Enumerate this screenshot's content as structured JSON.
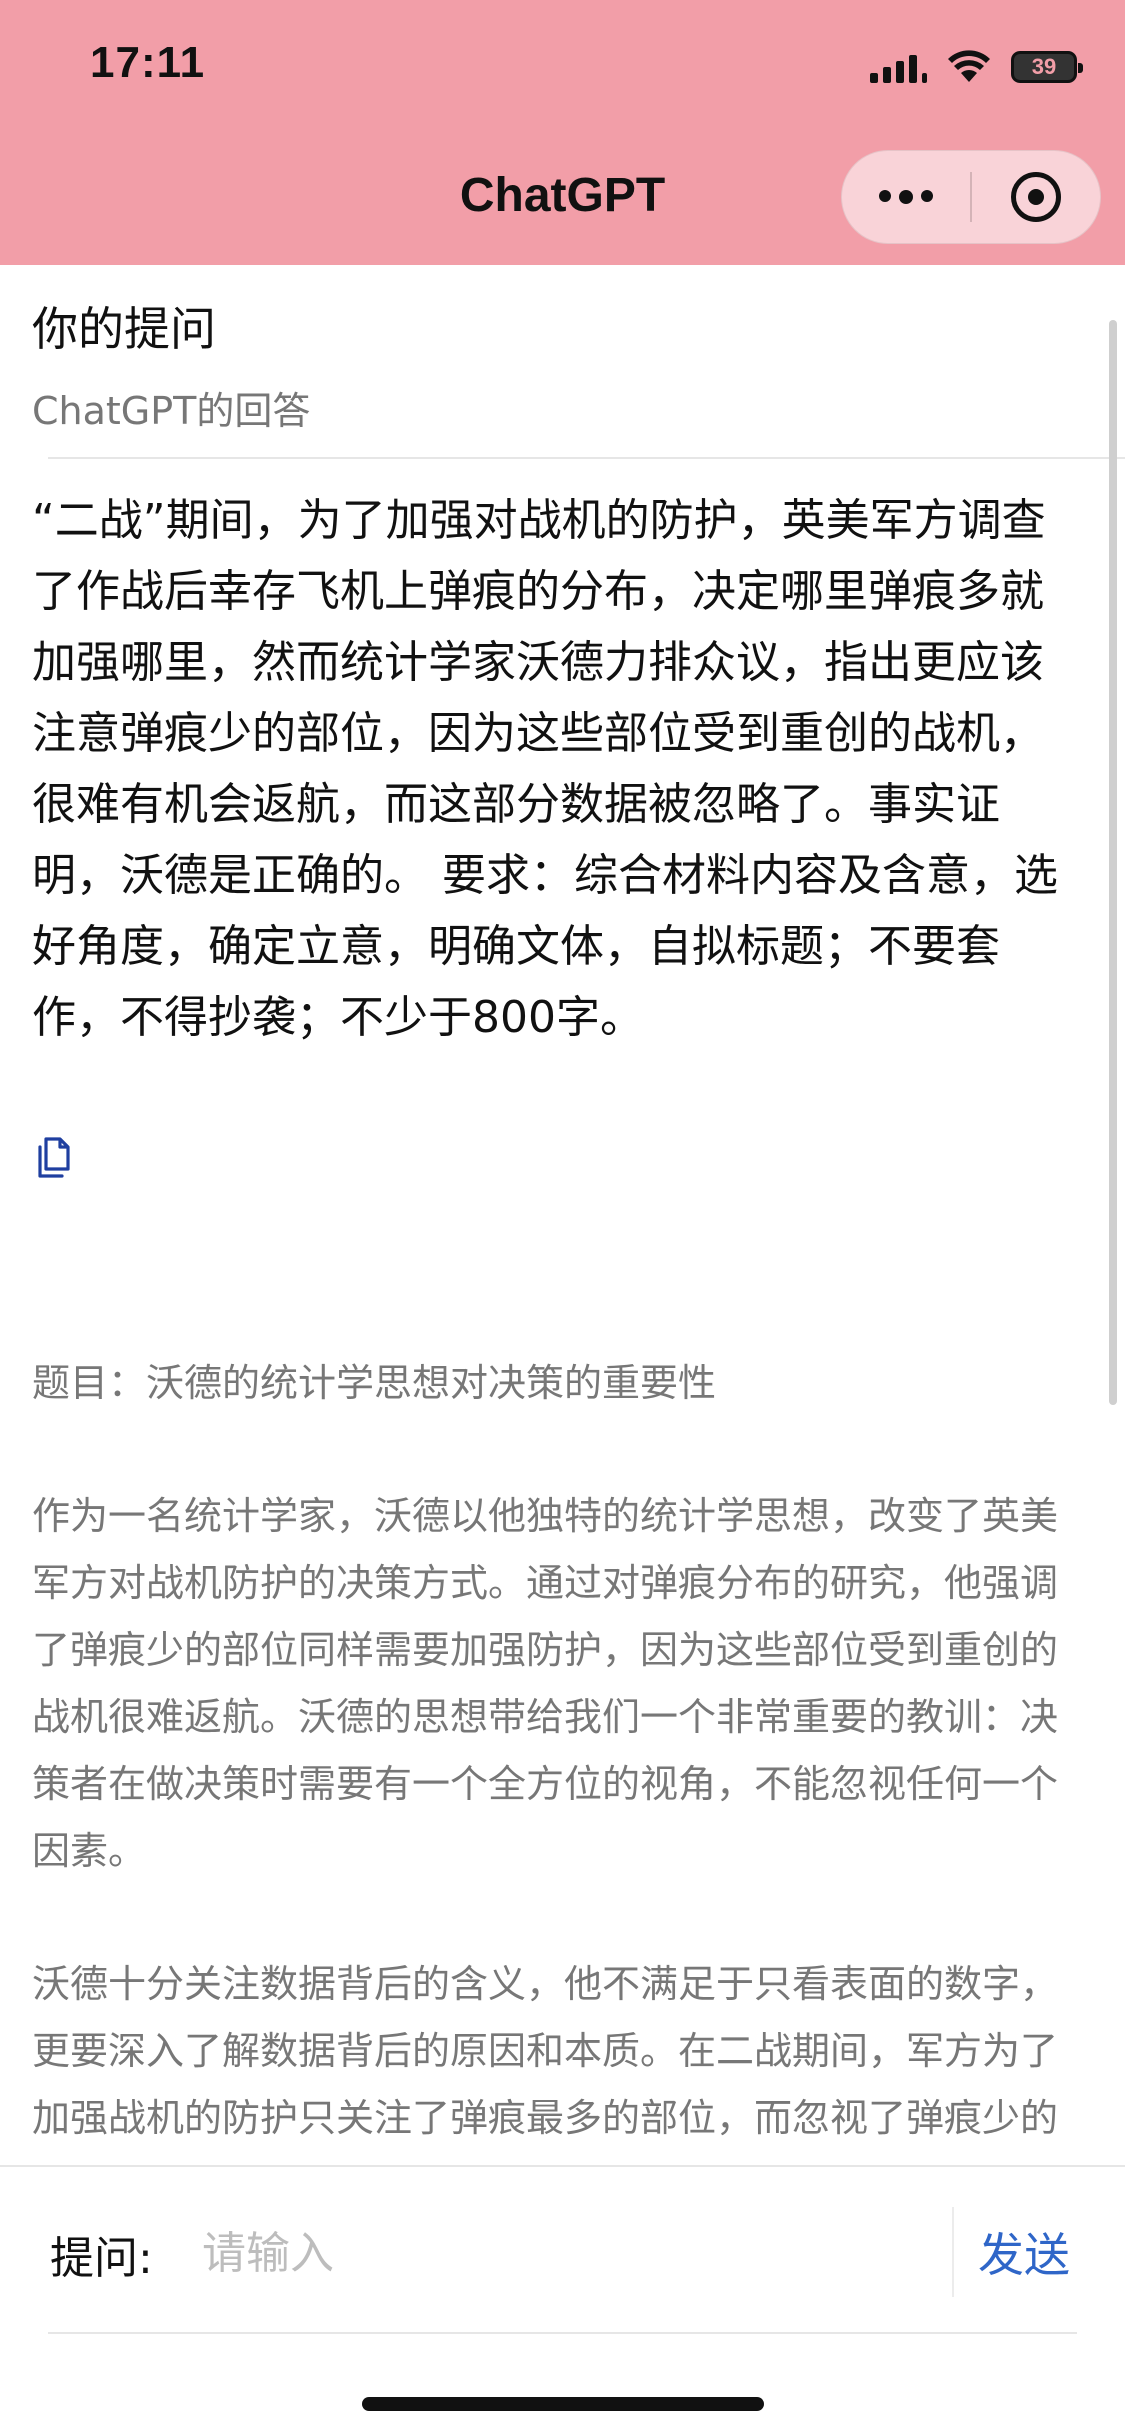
{
  "status_bar": {
    "time": "17:11",
    "battery": "39",
    "icons": [
      "signal-icon",
      "wifi-icon",
      "battery-icon"
    ]
  },
  "nav": {
    "title": "ChatGPT",
    "more_icon": "more-dots-icon",
    "close_icon": "target-icon"
  },
  "conversation": {
    "question_label": "你的提问",
    "answer_label": "ChatGPT的回答",
    "question_text": "“二战”期间，为了加强对战机的防护，英美军方调查了作战后幸存飞机上弹痕的分布，决定哪里弹痕多就加强哪里，然而统计学家沃德力排众议，指出更应该注意弹痕少的部位，因为这些部位受到重创的战机，很难有机会返航，而这部分数据被忽略了。事实证明，沃德是正确的。 要求：综合材料内容及含意，选好角度，确定立意，明确文体，自拟标题；不要套作，不得抄袭；不少于800字。",
    "copy_icon": "copy-icon",
    "answer_paragraphs": [
      "题目：沃德的统计学思想对决策的重要性",
      "作为一名统计学家，沃德以他独特的统计学思想，改变了英美军方对战机防护的决策方式。通过对弹痕分布的研究，他强调了弹痕少的部位同样需要加强防护，因为这些部位受到重创的战机很难返航。沃德的思想带给我们一个非常重要的教训：决策者在做决策时需要有一个全方位的视角，不能忽视任何一个因素。",
      "沃德十分关注数据背后的含义，他不满足于只看表面的数字，更要深入了解数据背后的原因和本质。在二战期间，军方为了加强战机的防护只关注了弹痕最多的部位，而忽视了弹痕少的部位。这意味着，只这些部位遭"
    ]
  },
  "input_bar": {
    "label": "提问:",
    "placeholder": "请输入",
    "value": "",
    "send_label": "发送"
  }
}
